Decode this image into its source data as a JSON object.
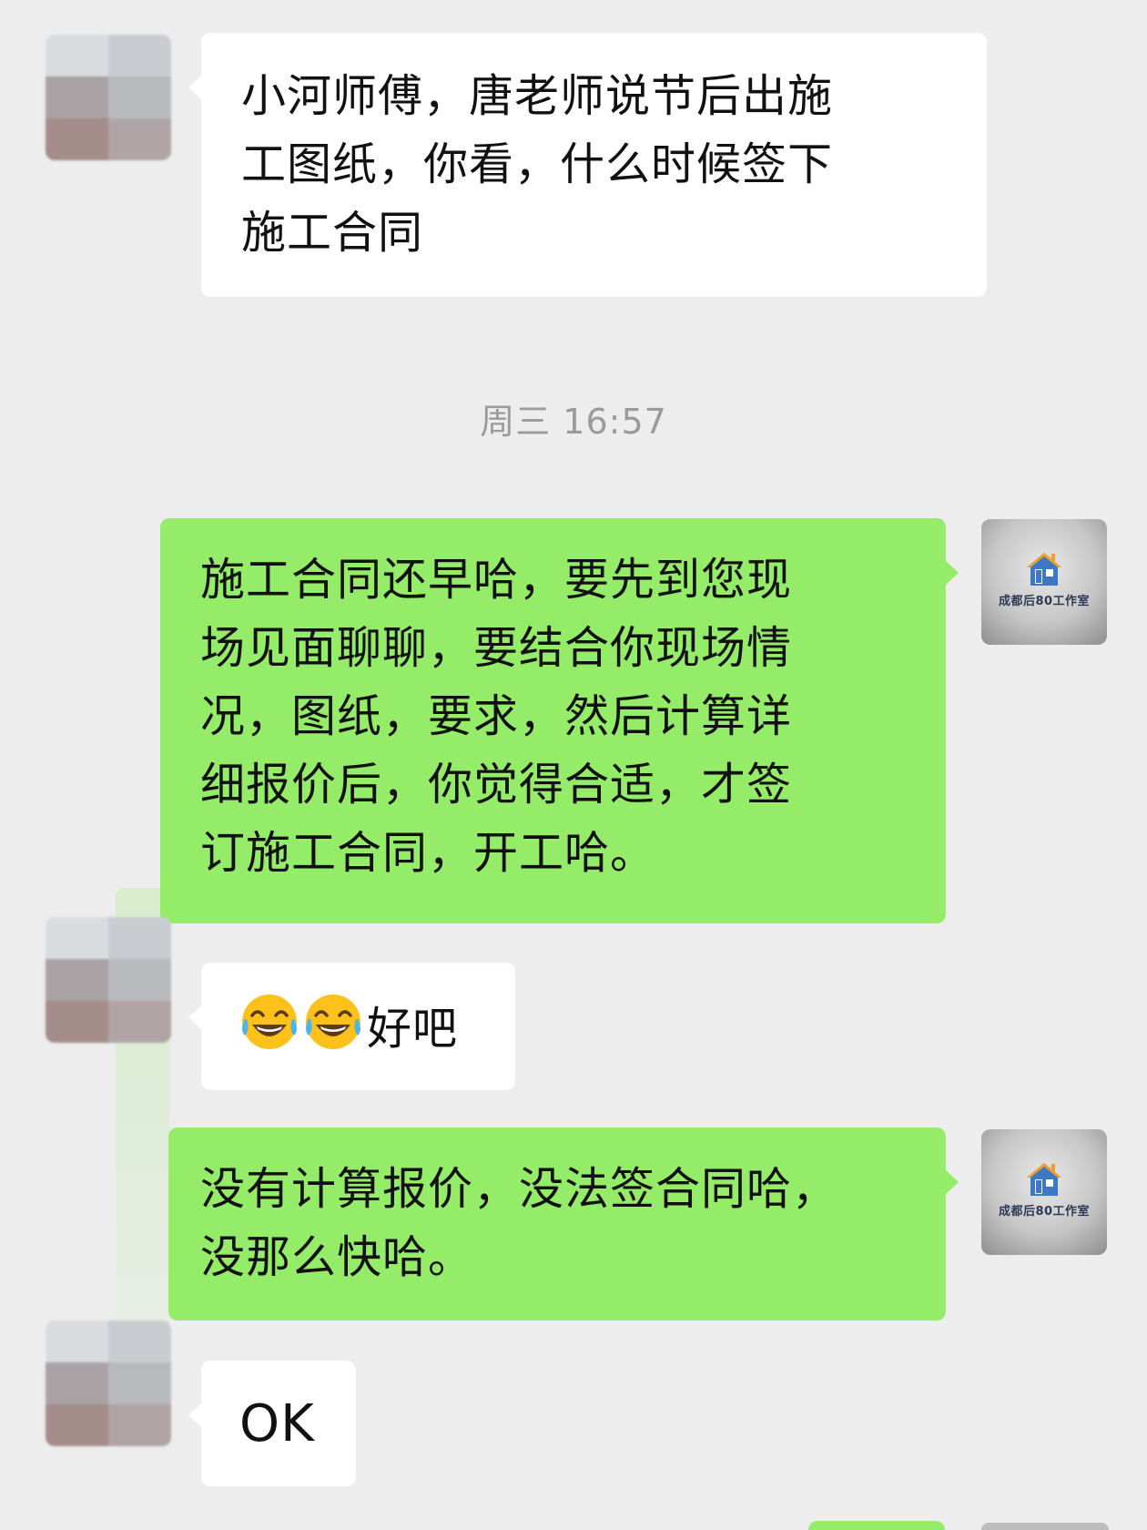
{
  "timestamp": "周三 16:57",
  "colors": {
    "background": "#ededed",
    "incoming_bubble": "#ffffff",
    "outgoing_bubble": "#95ec69",
    "timestamp_text": "#9b9b9b"
  },
  "my_avatar": {
    "icon": "house-logo-icon",
    "logo_text": "成都后80工作室"
  },
  "messages": [
    {
      "direction": "in",
      "lines": [
        "小河师傅，唐老师说节后出施",
        "工图纸，你看，什么时候签下",
        "施工合同"
      ]
    },
    {
      "direction": "out",
      "lines": [
        "施工合同还早哈，要先到您现",
        "场见面聊聊，要结合你现场情",
        "况，图纸，要求，然后计算详",
        "细报价后，你觉得合适，才签",
        "订施工合同，开工哈。"
      ]
    },
    {
      "direction": "in",
      "emojis": [
        "laughing-tears-emoji",
        "laughing-tears-emoji"
      ],
      "text": "好吧"
    },
    {
      "direction": "out",
      "lines": [
        "没有计算报价，没法签合同哈，",
        "没那么快哈。"
      ]
    },
    {
      "direction": "in",
      "text": "OK"
    }
  ]
}
